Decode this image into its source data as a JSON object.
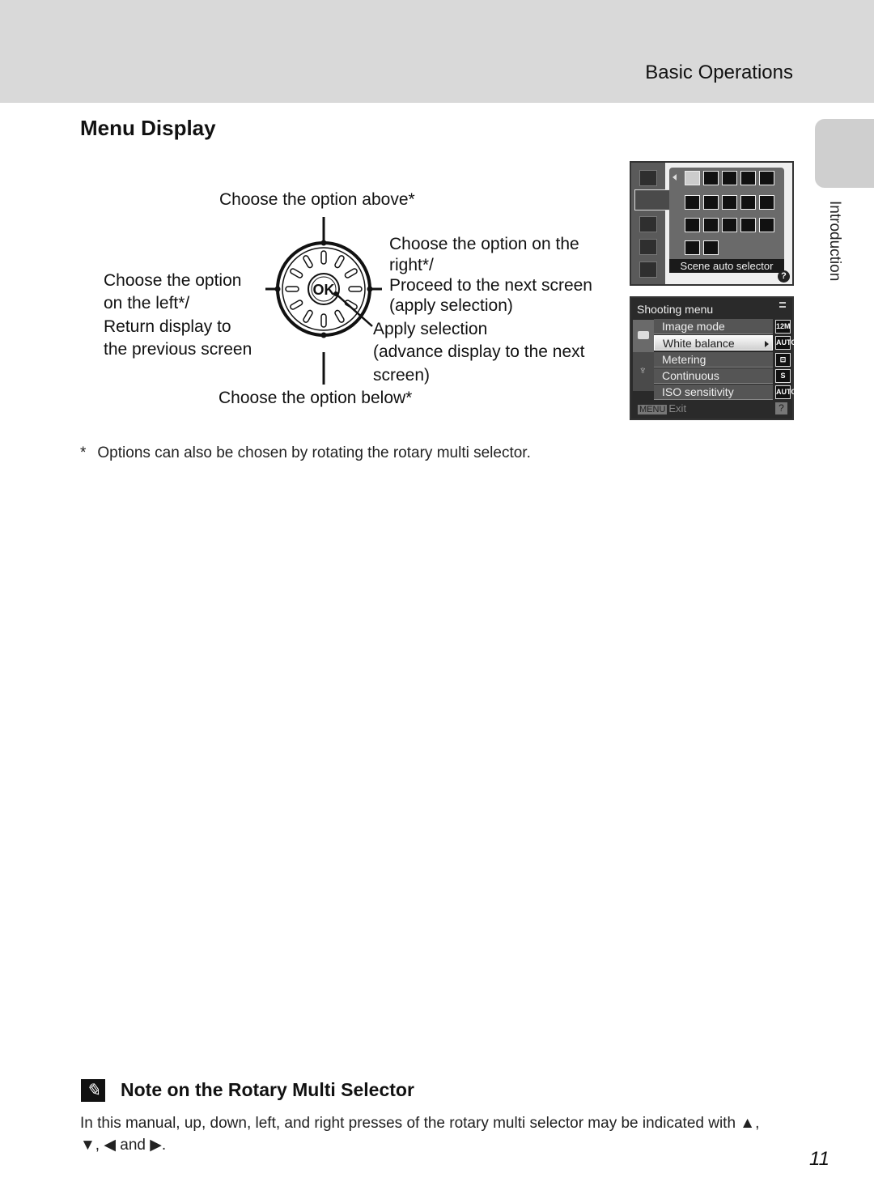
{
  "header": {
    "section_title": "Basic Operations"
  },
  "page": {
    "title": "Menu Display",
    "side_tab_label": "Introduction",
    "page_number": "11"
  },
  "diagram": {
    "ok_label": "OK",
    "above": "Choose the option above*",
    "below": "Choose the option below*",
    "left_line1": "Choose the option",
    "left_line2": "on the left*/",
    "left_line3": "Return display to",
    "left_line4": "the previous screen",
    "right_line1": "Choose the option on the",
    "right_line2": "right*/",
    "right_line3": "Proceed to the next screen",
    "right_line4": "(apply selection)",
    "center_line1": "Apply selection",
    "center_line2": "(advance display to the next",
    "center_line3": "screen)"
  },
  "footnote": {
    "star": "*",
    "text": "Options can also be chosen by rotating the rotary multi selector."
  },
  "scene_screen": {
    "caption": "Scene auto selector",
    "help": "?",
    "left_icons": [
      "camera-icon",
      "scene-icon",
      "smart-portrait-icon",
      "subject-tracking-icon",
      "movie-icon"
    ]
  },
  "shooting_menu": {
    "title": "Shooting menu",
    "items": [
      {
        "label": "Image mode",
        "value": "12M"
      },
      {
        "label": "White balance",
        "value": "AUTO",
        "selected": true
      },
      {
        "label": "Metering",
        "value": "⊡"
      },
      {
        "label": "Continuous",
        "value": "S"
      },
      {
        "label": "ISO sensitivity",
        "value": "AUTO"
      }
    ],
    "menu_key": "MENU",
    "exit_label": "Exit",
    "help": "?"
  },
  "note": {
    "icon": "✎",
    "title": "Note on the Rotary Multi Selector",
    "body_line1": "In this manual, up, down, left, and right presses of the rotary multi selector may be indicated with ▲,",
    "body_line2": "▼, ◀ and ▶."
  }
}
